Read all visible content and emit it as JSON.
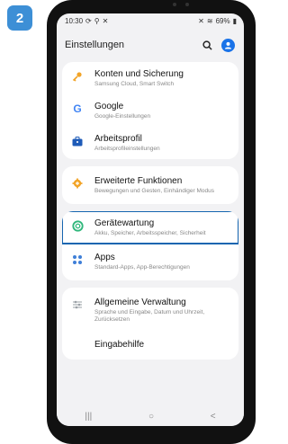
{
  "step": {
    "number": "2"
  },
  "status_bar": {
    "time": "10:30",
    "icons": [
      "sync-icon",
      "location-icon",
      "mute-icon"
    ],
    "battery": "69%"
  },
  "header": {
    "title": "Einstellungen"
  },
  "settings": [
    {
      "label": "Konten und Sicherung",
      "sub": "Samsung Cloud, Smart Switch",
      "icon": "key-icon",
      "color": "#f2a428"
    },
    {
      "label": "Google",
      "sub": "Google-Einstellungen",
      "icon": "google-icon",
      "color": "#4285f4"
    },
    {
      "label": "Arbeitsprofil",
      "sub": "Arbeitsprofileinstellungen",
      "icon": "briefcase-icon",
      "color": "#1e5bb8"
    },
    {
      "label": "Erweiterte Funktionen",
      "sub": "Bewegungen und Gesten, Einhändiger Modus",
      "icon": "gear-plus-icon",
      "color": "#f2a428"
    },
    {
      "label": "Gerätewartung",
      "sub": "Akku, Speicher, Arbeitsspeicher, Sicherheit",
      "icon": "device-care-icon",
      "color": "#2fb77b"
    },
    {
      "label": "Apps",
      "sub": "Standard-Apps, App-Berechtigungen",
      "icon": "apps-icon",
      "color": "#3f7fd8"
    },
    {
      "label": "Allgemeine Verwaltung",
      "sub": "Sprache und Eingabe, Datum und Uhrzeit, Zurücksetzen",
      "icon": "sliders-icon",
      "color": "#9aa0a6"
    },
    {
      "label": "Eingabehilfe",
      "sub": "",
      "icon": "accessibility-icon",
      "color": "#4ab0c7"
    }
  ],
  "nav": {
    "recent": "|||",
    "home": "○",
    "back": "<"
  },
  "accent": "#1565b0"
}
